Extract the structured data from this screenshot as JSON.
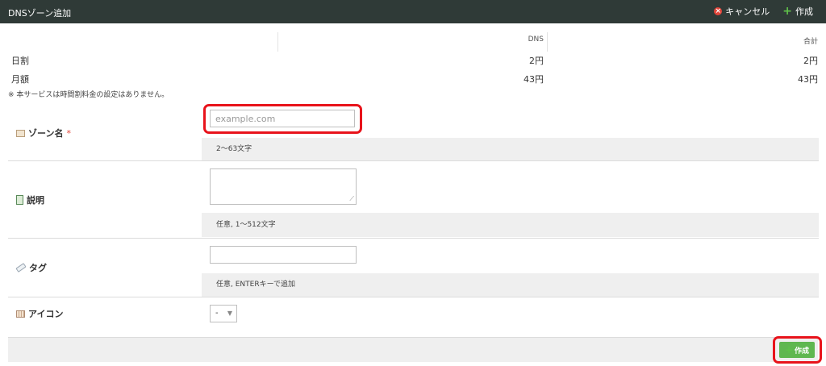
{
  "titlebar": {
    "title": "DNSゾーン追加",
    "cancel_label": "キャンセル",
    "create_label": "作成",
    "cancel_icon": "cancel-icon",
    "create_icon": "plus-icon"
  },
  "price_table": {
    "headers": [
      "DNS",
      "合計"
    ],
    "rows": [
      {
        "label": "日割",
        "dns": "2円",
        "total": "2円"
      },
      {
        "label": "月額",
        "dns": "43円",
        "total": "43円"
      }
    ],
    "note": "※ 本サービスは時間割料金の設定はありません。"
  },
  "form": {
    "zone_name": {
      "label": "ゾーン名",
      "required_mark": "*",
      "placeholder": "example.com",
      "hint": "2〜63文字",
      "icon": "zone-icon"
    },
    "description": {
      "label": "説明",
      "value": "",
      "hint": "任意, 1〜512文字",
      "icon": "description-icon"
    },
    "tags": {
      "label": "タグ",
      "value": "",
      "hint": "任意, ENTERキーで追加",
      "icon": "tag-icon"
    },
    "icon": {
      "label": "アイコン",
      "selected": "-",
      "icon": "icon-picker-icon"
    }
  },
  "footer": {
    "create_label": "作成"
  },
  "colors": {
    "titlebar_bg": "#2f3a37",
    "accent_green": "#5fb750",
    "highlight_red": "#e8131b"
  }
}
